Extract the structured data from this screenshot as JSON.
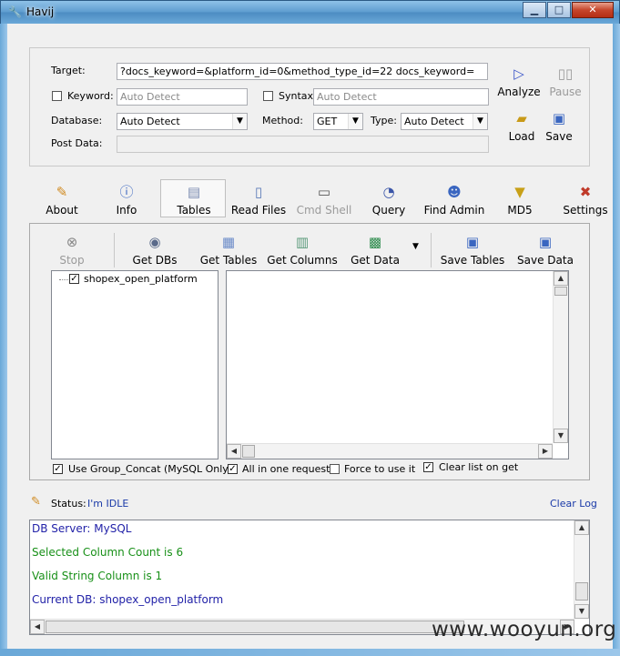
{
  "window": {
    "title": "Havij",
    "minimize": "▁",
    "maximize": "□",
    "close": "✕",
    "app_icon": "wrench-icon"
  },
  "form": {
    "target_label": "Target:",
    "target_value": "?docs_keyword=&platform_id=0&method_type_id=22 docs_keyword=",
    "keyword_label": "Keyword:",
    "keyword_placeholder": "Auto Detect",
    "syntax_label": "Syntax:",
    "syntax_placeholder": "Auto Detect",
    "database_label": "Database:",
    "database_value": "Auto Detect",
    "method_label": "Method:",
    "method_value": "GET",
    "type_label": "Type:",
    "type_value": "Auto Detect",
    "postdata_label": "Post Data:",
    "postdata_value": ""
  },
  "actions": {
    "analyze": "Analyze",
    "pause": "Pause",
    "load": "Load",
    "save": "Save"
  },
  "tabs": [
    {
      "label": "About",
      "icon": "pencil-icon"
    },
    {
      "label": "Info",
      "icon": "info-icon"
    },
    {
      "label": "Tables",
      "icon": "table-icon"
    },
    {
      "label": "Read Files",
      "icon": "document-icon"
    },
    {
      "label": "Cmd Shell",
      "icon": "terminal-icon"
    },
    {
      "label": "Query",
      "icon": "query-icon"
    },
    {
      "label": "Find Admin",
      "icon": "users-icon"
    },
    {
      "label": "MD5",
      "icon": "funnel-icon"
    },
    {
      "label": "Settings",
      "icon": "tools-icon"
    }
  ],
  "tables_toolbar": {
    "stop": "Stop",
    "get_dbs": "Get DBs",
    "get_tables": "Get Tables",
    "get_columns": "Get Columns",
    "get_data": "Get Data",
    "save_tables": "Save Tables",
    "save_data": "Save Data"
  },
  "tree": {
    "items": [
      "shopex_open_platform"
    ]
  },
  "options": {
    "group_concat": "Use Group_Concat (MySQL Only)",
    "all_in_one": "All in one request.",
    "force": "Force to use it",
    "clear_list": "Clear list on get"
  },
  "status": {
    "label": "Status:",
    "value": "I'm IDLE",
    "clear_log": "Clear Log"
  },
  "log": [
    {
      "text": "DB Server: MySQL",
      "color": "#2222a8"
    },
    {
      "text": "Selected Column Count is 6",
      "color": "#189018"
    },
    {
      "text": "Valid String Column is 1",
      "color": "#189018"
    },
    {
      "text": "Current DB: shopex_open_platform",
      "color": "#2222a8"
    }
  ],
  "watermark": "www.wooyun.org"
}
